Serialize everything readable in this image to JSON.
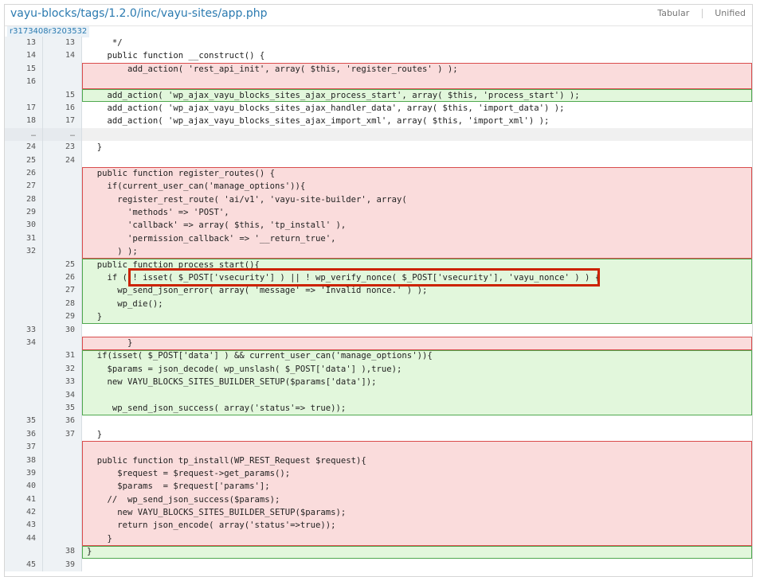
{
  "header": {
    "path": "vayu-blocks/tags/1.2.0/inc/vayu-sites/app.php",
    "view_tabular": "Tabular",
    "view_unified": "Unified",
    "revision": "r3173408r3203532"
  },
  "rows": [
    {
      "type": "ctx",
      "old": "13",
      "new": "13",
      "code": "     */"
    },
    {
      "type": "ctx",
      "old": "14",
      "new": "14",
      "code": "    public function __construct() {"
    },
    {
      "type": "del",
      "old": "15",
      "new": "",
      "code": "        add_action( 'rest_api_init', array( $this, 'register_routes' ) );"
    },
    {
      "type": "del",
      "old": "16",
      "new": "",
      "code": ""
    },
    {
      "type": "add",
      "old": "",
      "new": "15",
      "code": "    add_action( 'wp_ajax_vayu_blocks_sites_ajax_process_start', array( $this, 'process_start') );"
    },
    {
      "type": "ctx",
      "old": "17",
      "new": "16",
      "code": "    add_action( 'wp_ajax_vayu_blocks_sites_ajax_handler_data', array( $this, 'import_data') );"
    },
    {
      "type": "ctx",
      "old": "18",
      "new": "17",
      "code": "    add_action( 'wp_ajax_vayu_blocks_sites_ajax_import_xml', array( $this, 'import_xml') );"
    },
    {
      "type": "skip",
      "old": "…",
      "new": "…",
      "code": ""
    },
    {
      "type": "ctx",
      "old": "24",
      "new": "23",
      "code": "  }"
    },
    {
      "type": "ctx",
      "old": "25",
      "new": "24",
      "code": ""
    },
    {
      "type": "del",
      "old": "26",
      "new": "",
      "code": "  public function register_routes() {"
    },
    {
      "type": "del",
      "old": "27",
      "new": "",
      "code": "    if(current_user_can('manage_options')){"
    },
    {
      "type": "del",
      "old": "28",
      "new": "",
      "code": "      register_rest_route( 'ai/v1', 'vayu-site-builder', array("
    },
    {
      "type": "del",
      "old": "29",
      "new": "",
      "code": "        'methods' => 'POST',"
    },
    {
      "type": "del",
      "old": "30",
      "new": "",
      "code": "        'callback' => array( $this, 'tp_install' ),"
    },
    {
      "type": "del",
      "old": "31",
      "new": "",
      "code": "        'permission_callback' => '__return_true',"
    },
    {
      "type": "del",
      "old": "32",
      "new": "",
      "code": "      ) );"
    },
    {
      "type": "add",
      "old": "",
      "new": "25",
      "code": "  public function process_start(){"
    },
    {
      "type": "add",
      "old": "",
      "new": "26",
      "code": "    if ( ! isset( $_POST['vsecurity'] ) || ! wp_verify_nonce( $_POST['vsecurity'], 'vayu_nonce' ) ) {"
    },
    {
      "type": "add",
      "old": "",
      "new": "27",
      "code": "      wp_send_json_error( array( 'message' => 'Invalid nonce.' ) );"
    },
    {
      "type": "add",
      "old": "",
      "new": "28",
      "code": "      wp_die();"
    },
    {
      "type": "add",
      "old": "",
      "new": "29",
      "code": "  }"
    },
    {
      "type": "ctx",
      "old": "33",
      "new": "30",
      "code": ""
    },
    {
      "type": "del",
      "old": "34",
      "new": "",
      "code": "        }"
    },
    {
      "type": "add",
      "old": "",
      "new": "31",
      "code": "  if(isset( $_POST['data'] ) && current_user_can('manage_options')){"
    },
    {
      "type": "add",
      "old": "",
      "new": "32",
      "code": "    $params = json_decode( wp_unslash( $_POST['data'] ),true);"
    },
    {
      "type": "add",
      "old": "",
      "new": "33",
      "code": "    new VAYU_BLOCKS_SITES_BUILDER_SETUP($params['data']);"
    },
    {
      "type": "add",
      "old": "",
      "new": "34",
      "code": ""
    },
    {
      "type": "add",
      "old": "",
      "new": "35",
      "code": "     wp_send_json_success( array('status'=> true));"
    },
    {
      "type": "ctx",
      "old": "35",
      "new": "36",
      "code": ""
    },
    {
      "type": "ctx",
      "old": "36",
      "new": "37",
      "code": "  }"
    },
    {
      "type": "del",
      "old": "37",
      "new": "",
      "code": ""
    },
    {
      "type": "del",
      "old": "38",
      "new": "",
      "code": "  public function tp_install(WP_REST_Request $request){"
    },
    {
      "type": "del",
      "old": "39",
      "new": "",
      "code": "      $request = $request->get_params();"
    },
    {
      "type": "del",
      "old": "40",
      "new": "",
      "code": "      $params  = $request['params'];"
    },
    {
      "type": "del",
      "old": "41",
      "new": "",
      "code": "    //  wp_send_json_success($params);"
    },
    {
      "type": "del",
      "old": "42",
      "new": "",
      "code": "      new VAYU_BLOCKS_SITES_BUILDER_SETUP($params);"
    },
    {
      "type": "del",
      "old": "43",
      "new": "",
      "code": "      return json_encode( array('status'=>true));"
    },
    {
      "type": "del",
      "old": "44",
      "new": "",
      "code": "    }"
    },
    {
      "type": "add",
      "old": "",
      "new": "38",
      "code": "}"
    },
    {
      "type": "ctx",
      "old": "45",
      "new": "39",
      "code": ""
    }
  ],
  "colors": {
    "deleted_bg": "#fadcdc",
    "added_bg": "#e2f7dc",
    "highlight": "#cc2200",
    "link": "#2a7ab0"
  }
}
